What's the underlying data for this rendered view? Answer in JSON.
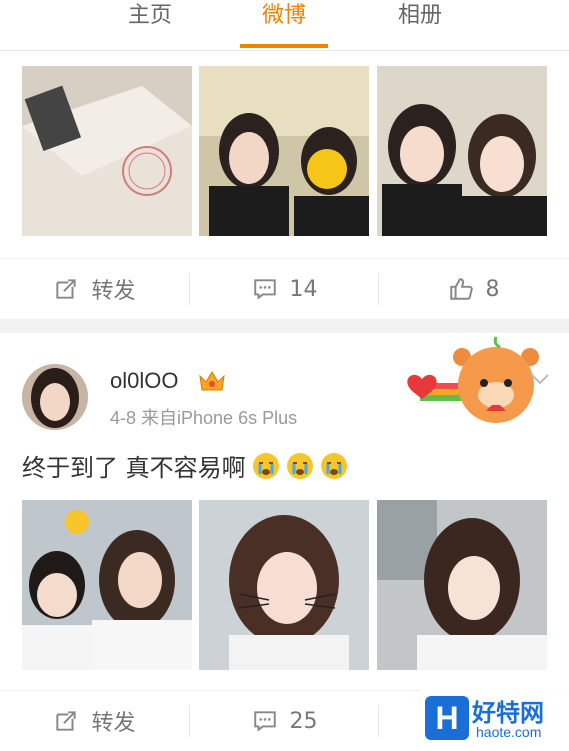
{
  "tabs": [
    {
      "label": "主页",
      "active": false
    },
    {
      "label": "微博",
      "active": true
    },
    {
      "label": "相册",
      "active": false
    }
  ],
  "accent_color": "#f08300",
  "post1": {
    "images": [
      "pizza-box-photo",
      "two-girls-selfie-photo",
      "two-girls-cat-filter-photo"
    ],
    "actions": {
      "repost_label": "转发",
      "comment_count": "14",
      "like_count": "8"
    }
  },
  "post2": {
    "username": "ol0lOO",
    "meta": "4-8  来自iPhone 6s Plus",
    "text": "终于到了 真不容易啊",
    "images": [
      "couple-selfie-photo",
      "girl-cat-filter-photo",
      "girl-portrait-photo"
    ],
    "actions": {
      "repost_label": "转发",
      "comment_count": "25"
    }
  },
  "watermark": {
    "logo": "H",
    "title": "好特网",
    "url": "haote.com"
  }
}
